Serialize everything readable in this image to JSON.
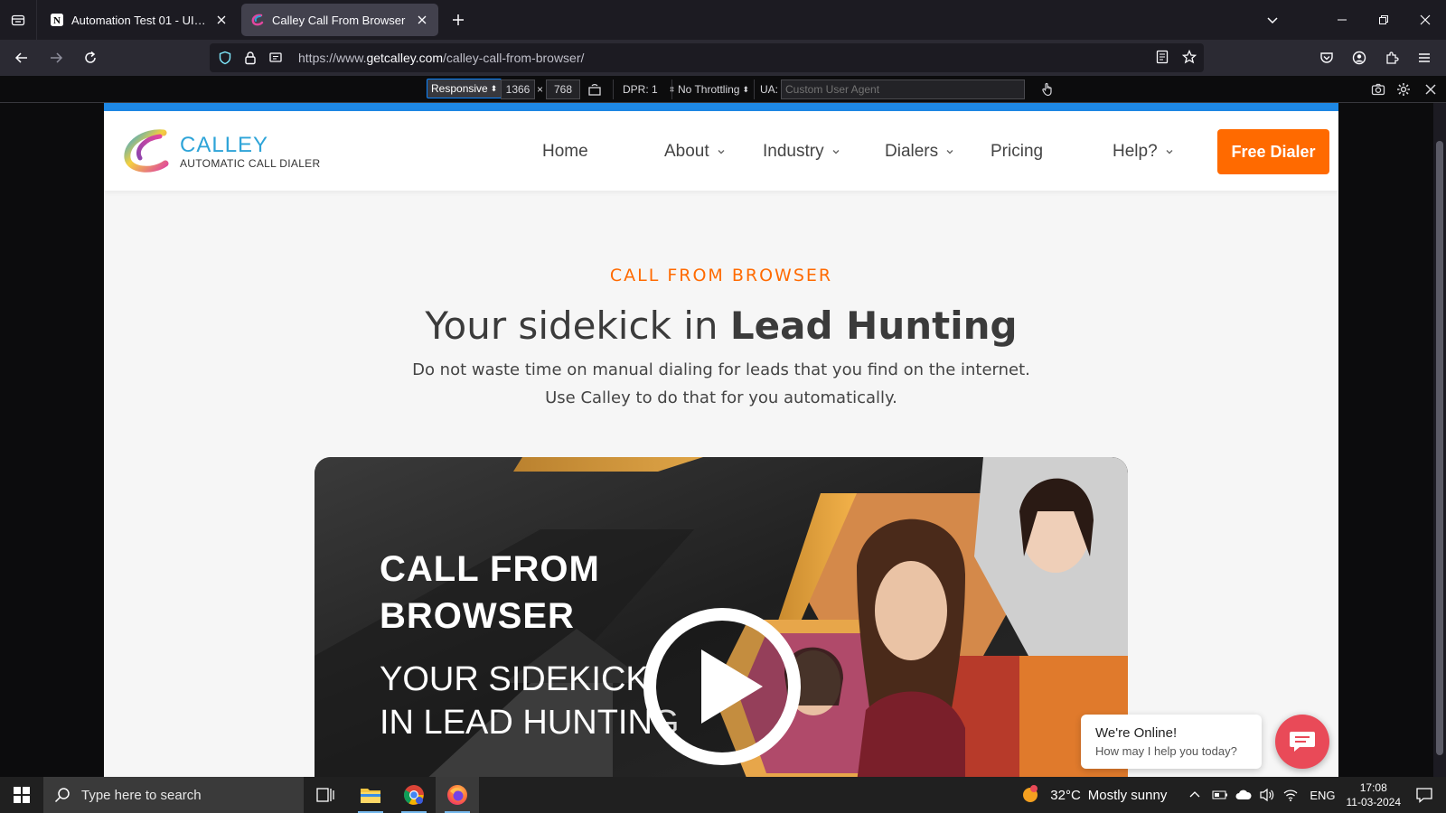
{
  "browser": {
    "tabs": [
      {
        "title": "Automation Test 01 - UI Testing",
        "active": false,
        "icon": "notion-icon"
      },
      {
        "title": "Calley Call From Browser",
        "active": true,
        "icon": "calley-icon"
      }
    ],
    "url_prefix": "https://www.",
    "url_host": "getcalley.com",
    "url_path": "/calley-call-from-browser/"
  },
  "rdm": {
    "device": "Responsive",
    "width": "1366",
    "times": "×",
    "height": "768",
    "dpr": "DPR: 1",
    "throttling": "No Throttling",
    "ua_label": "UA:",
    "ua_placeholder": "Custom User Agent"
  },
  "site": {
    "logo_name": "CALLEY",
    "logo_sub": "AUTOMATIC CALL DIALER",
    "nav": {
      "home": "Home",
      "about": "About",
      "industry": "Industry",
      "dialers": "Dialers",
      "pricing": "Pricing",
      "help": "Help?"
    },
    "cta": "Free Dialer",
    "eyebrow": "CALL FROM BROWSER",
    "headline_plain": "Your sidekick in ",
    "headline_bold": "Lead Hunting",
    "sub_line1": "Do not waste time on manual dialing for leads that you find on the internet.",
    "sub_line2": "Use Calley to do that for you automatically.",
    "video_title_1": "CALL FROM",
    "video_title_2": "BROWSER",
    "video_sub_1": "YOUR SIDEKICK",
    "video_sub_2": "IN LEAD HUNTING",
    "chat_title": "We're Online!",
    "chat_sub": "How may I help you today?"
  },
  "taskbar": {
    "search_placeholder": "Type here to search",
    "temperature": "32°C",
    "weather": "Mostly sunny",
    "language": "ENG",
    "time": "17:08",
    "date": "11-03-2024"
  },
  "colors": {
    "accent_orange": "#ff6a00",
    "calley_blue": "#2ea4d8",
    "chat_red": "#e94a58"
  }
}
